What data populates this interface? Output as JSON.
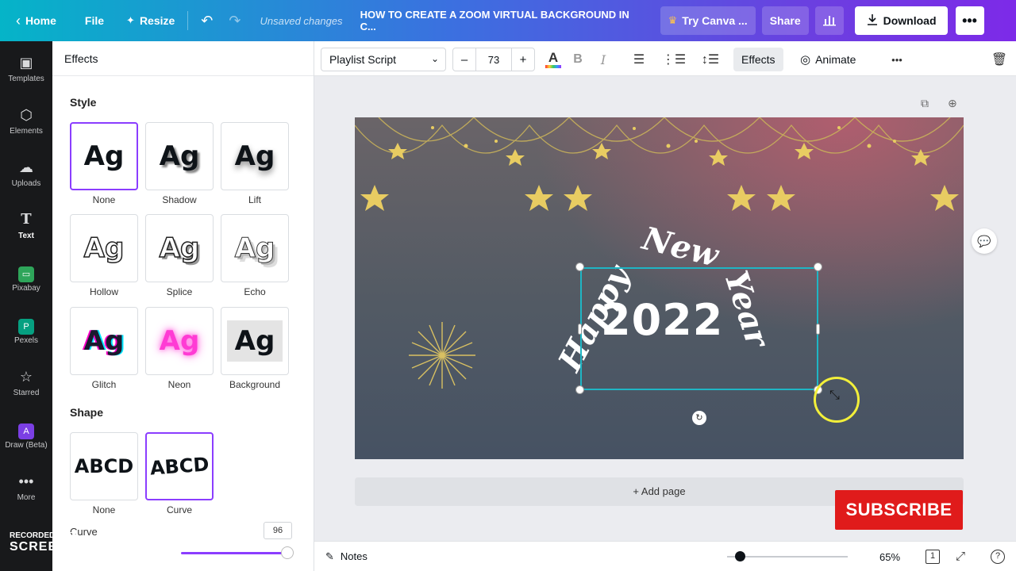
{
  "topbar": {
    "home": "Home",
    "file": "File",
    "resize": "Resize",
    "unsaved": "Unsaved changes",
    "doc_title": "HOW TO CREATE A ZOOM VIRTUAL BACKGROUND IN C...",
    "try_canva": "Try Canva ...",
    "share": "Share",
    "download": "Download"
  },
  "rail": [
    {
      "label": "Templates",
      "icon": "templates-icon"
    },
    {
      "label": "Elements",
      "icon": "elements-icon"
    },
    {
      "label": "Uploads",
      "icon": "uploads-icon"
    },
    {
      "label": "Text",
      "icon": "text-icon"
    },
    {
      "label": "Pixabay",
      "icon": "pixabay-icon"
    },
    {
      "label": "Pexels",
      "icon": "pexels-icon"
    },
    {
      "label": "Starred",
      "icon": "starred-icon"
    },
    {
      "label": "Draw (Beta)",
      "icon": "draw-icon"
    },
    {
      "label": "More",
      "icon": "more-icon"
    }
  ],
  "panel": {
    "title": "Effects",
    "style_title": "Style",
    "styles": [
      {
        "label": "None",
        "sample": "Ag"
      },
      {
        "label": "Shadow",
        "sample": "Ag"
      },
      {
        "label": "Lift",
        "sample": "Ag"
      },
      {
        "label": "Hollow",
        "sample": "Ag"
      },
      {
        "label": "Splice",
        "sample": "Ag"
      },
      {
        "label": "Echo",
        "sample": "Ag"
      },
      {
        "label": "Glitch",
        "sample": "Ag"
      },
      {
        "label": "Neon",
        "sample": "Ag"
      },
      {
        "label": "Background",
        "sample": "Ag"
      }
    ],
    "selected_style": "None",
    "shape_title": "Shape",
    "shapes": [
      {
        "label": "None",
        "sample": "ABCD"
      },
      {
        "label": "Curve",
        "sample": "ABCD"
      }
    ],
    "selected_shape": "Curve",
    "curve_label": "Curve",
    "curve_value": "96"
  },
  "toolbar": {
    "font": "Playlist Script",
    "minus": "–",
    "size": "73",
    "plus": "+",
    "effects": "Effects",
    "animate": "Animate"
  },
  "canvas": {
    "year": "2022",
    "script_words": [
      "Happy",
      "New",
      "Year"
    ],
    "add_page": "+ Add page"
  },
  "bottombar": {
    "notes": "Notes",
    "zoom": "65%",
    "page_count": "1"
  },
  "overlay": {
    "subscribe": "SUBSCRIBE",
    "recorded_with": "RECORDED WITH",
    "brand": "SCREENCAST MATIC"
  },
  "colors": {
    "accent_purple": "#8b3dff",
    "selection_teal": "#1fb5c4",
    "subscribe_red": "#e01b1b"
  }
}
